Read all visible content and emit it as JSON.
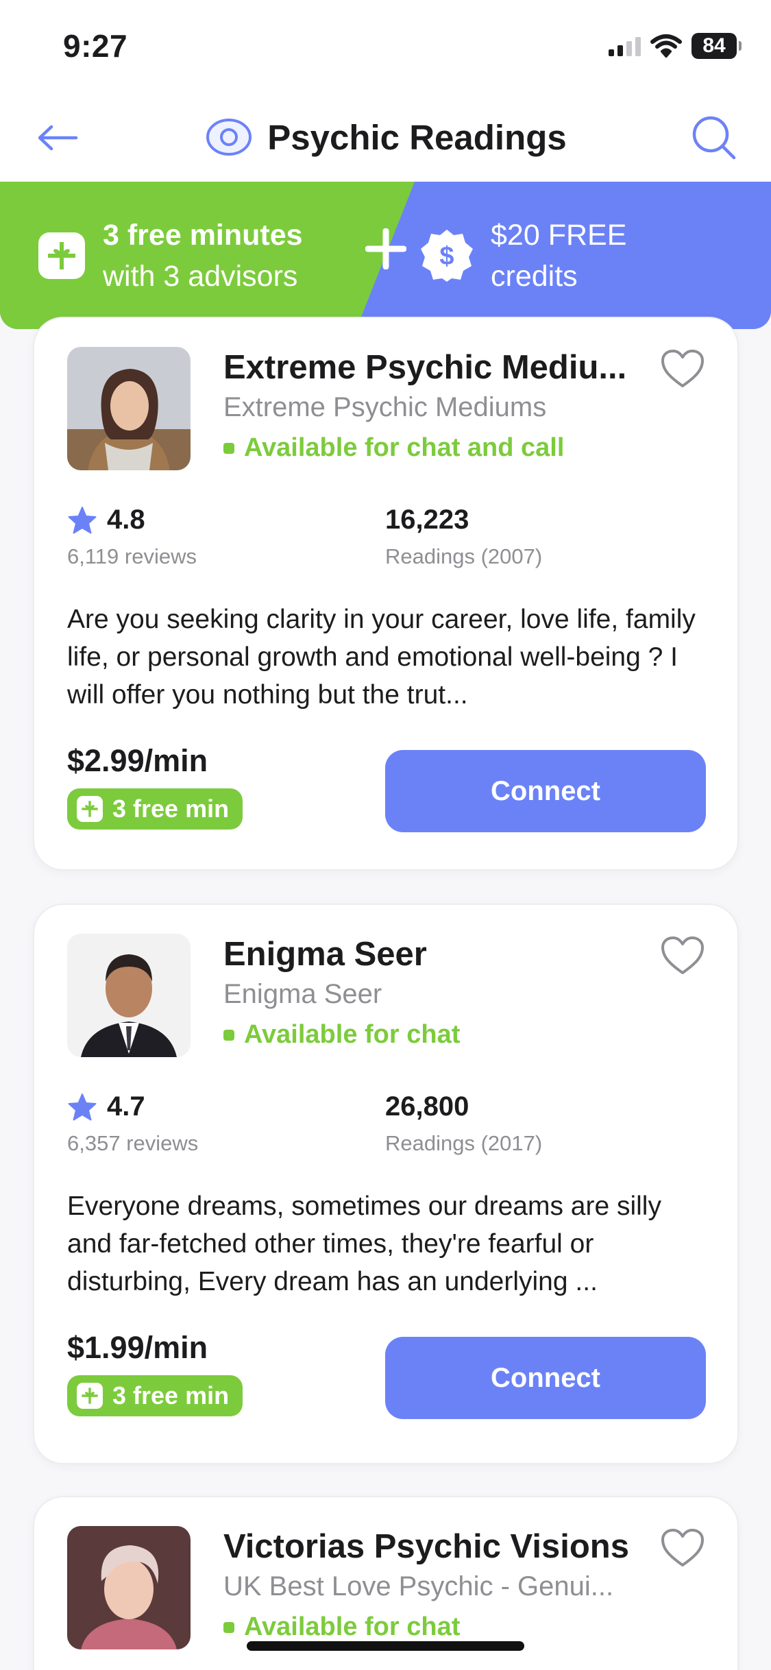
{
  "status_bar": {
    "time": "9:27",
    "battery": "84"
  },
  "header": {
    "title": "Psychic Readings"
  },
  "promo": {
    "left_line1": "3 free minutes",
    "left_line2": "with 3 advisors",
    "plus": "+",
    "right_line1": "$20 FREE",
    "right_line2": "credits",
    "colors": {
      "green": "#7ccb3c",
      "blue": "#6b82f7"
    }
  },
  "advisors": [
    {
      "name": "Extreme Psychic Mediu...",
      "subtitle": "Extreme Psychic Mediums",
      "status": "Available for chat and call",
      "rating": "4.8",
      "reviews": "6,119 reviews",
      "readings": "16,223",
      "readings_label": "Readings (2007)",
      "description": "Are you seeking clarity in your career, love life, family life, or personal growth and emotional well-being ? I will offer you nothing but the trut...",
      "price": "$2.99/min",
      "free_badge": "3 free min",
      "button": "Connect"
    },
    {
      "name": "Enigma Seer",
      "subtitle": "Enigma Seer",
      "status": "Available for chat",
      "rating": "4.7",
      "reviews": "6,357 reviews",
      "readings": "26,800",
      "readings_label": "Readings (2017)",
      "description": "Everyone dreams, sometimes our dreams are silly and far-fetched other times, they're fearful or disturbing, Every dream has an underlying ...",
      "price": "$1.99/min",
      "free_badge": "3 free min",
      "button": "Connect"
    },
    {
      "name": "Victorias Psychic Visions",
      "subtitle": "UK Best Love Psychic - Genui...",
      "status": "Available for chat"
    }
  ]
}
